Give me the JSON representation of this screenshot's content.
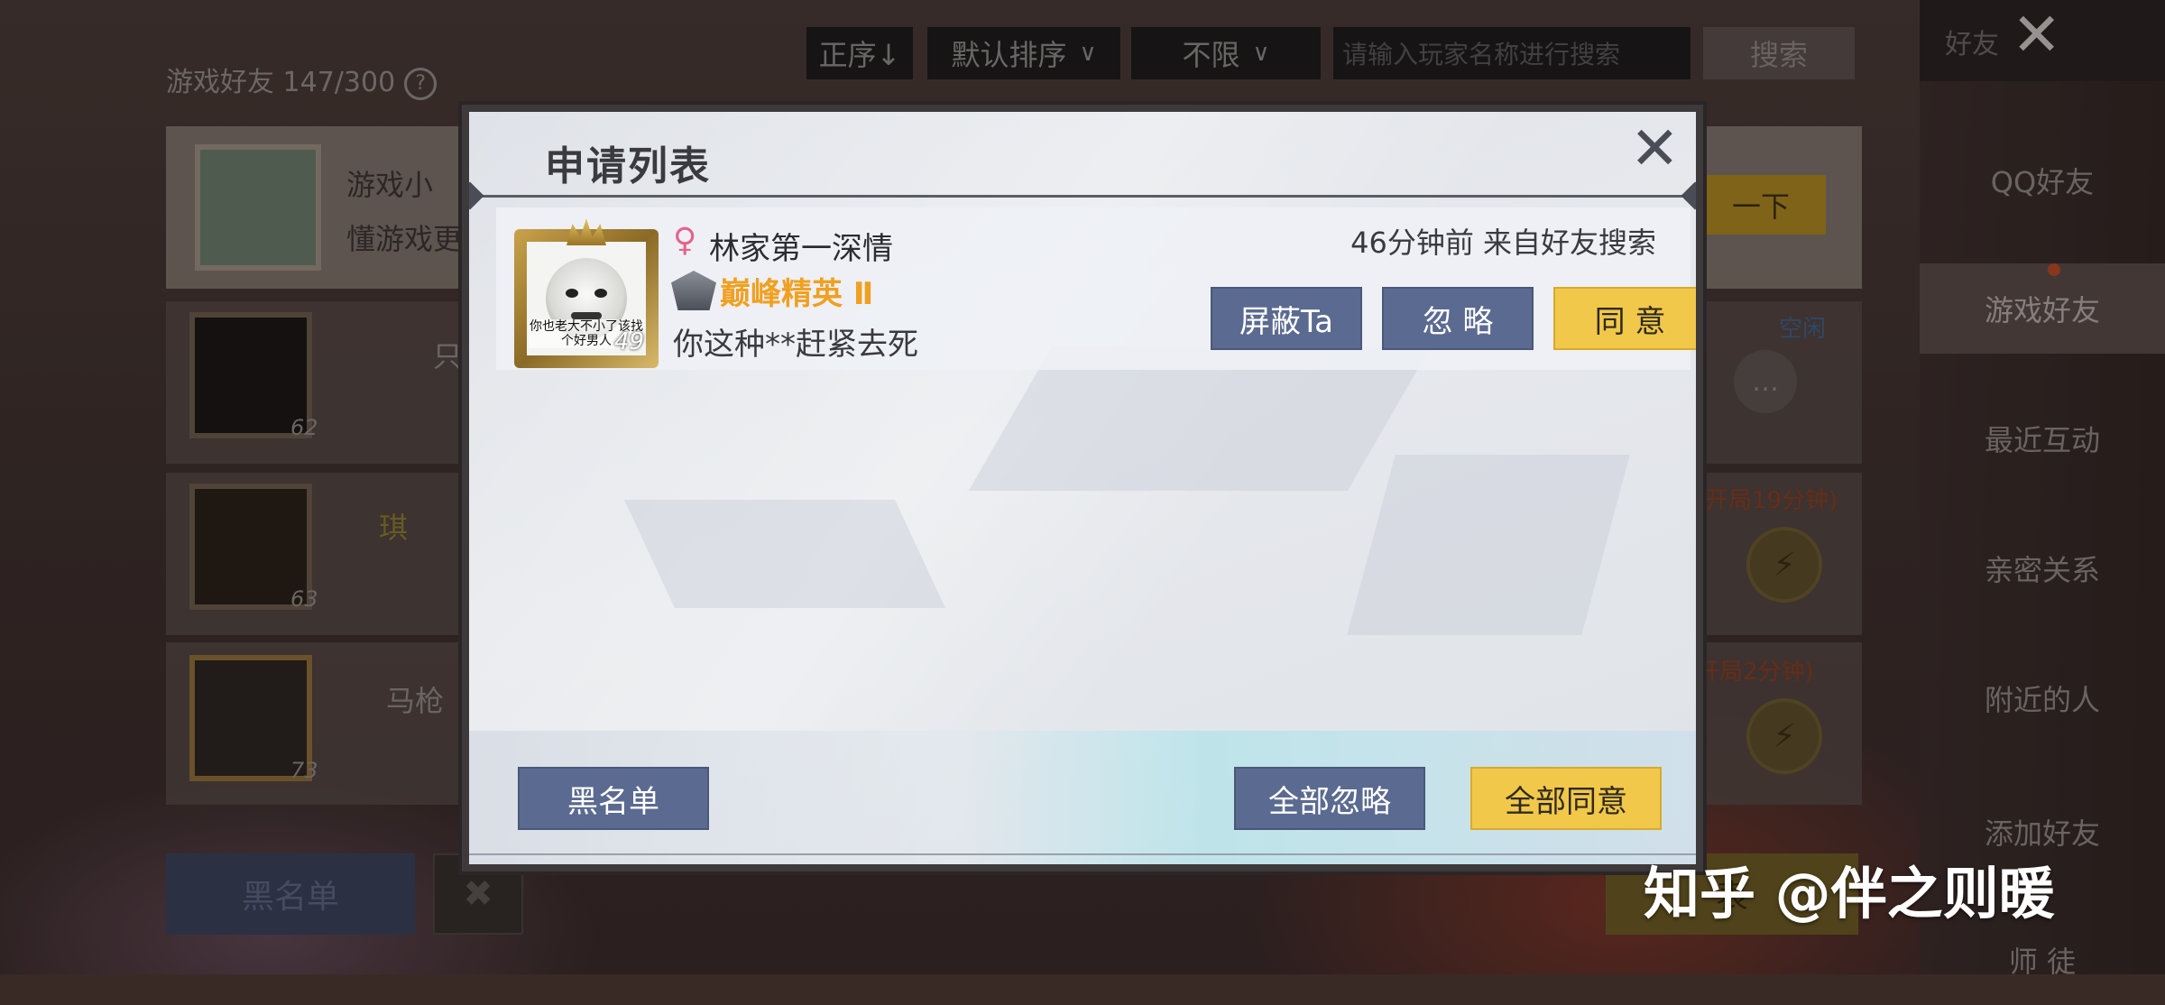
{
  "background": {
    "friends_title": "游戏好友 147/300",
    "filters": {
      "order": "正序↓",
      "sort": "默认排序",
      "limit": "不限",
      "search_placeholder": "请输入玩家名称进行搜索",
      "search_button": "搜索"
    },
    "sidebar": {
      "header": "好友",
      "items": [
        "QQ好友",
        "游戏好友",
        "最近互动",
        "亲密关系",
        "附近的人",
        "添加好友",
        "师 徒"
      ]
    },
    "rows": [
      {
        "name": "游戏小",
        "subtitle": "懂游戏更",
        "action": "一下"
      },
      {
        "level": "62",
        "name": "只",
        "status": "空闲"
      },
      {
        "level": "63",
        "name": "琪",
        "status": "开局19分钟)"
      },
      {
        "level": "73",
        "name": "马枪",
        "status": "开局2分钟)"
      }
    ],
    "blacklist_button": "黑名单",
    "right_button": "表"
  },
  "dialog": {
    "title": "申请列表",
    "request": {
      "name": "林家第一深情",
      "gender_symbol": "♀",
      "rank": "巅峰精英 Ⅱ",
      "message": "你这种**赶紧去死",
      "time_source": "46分钟前 来自好友搜索",
      "avatar_level": "49",
      "avatar_caption": "你也老大不小了该找个好男人",
      "block_button": "屏蔽Ta",
      "ignore_button": "忽 略",
      "accept_button": "同 意"
    },
    "footer": {
      "blacklist": "黑名单",
      "ignore_all": "全部忽略",
      "accept_all": "全部同意"
    }
  },
  "watermark": "知乎 @伴之则暖",
  "colors": {
    "accent_yellow": "#f1c84a",
    "button_blue": "#5b6a90",
    "rank_orange": "#f0a020",
    "female_pink": "#e4648a"
  }
}
